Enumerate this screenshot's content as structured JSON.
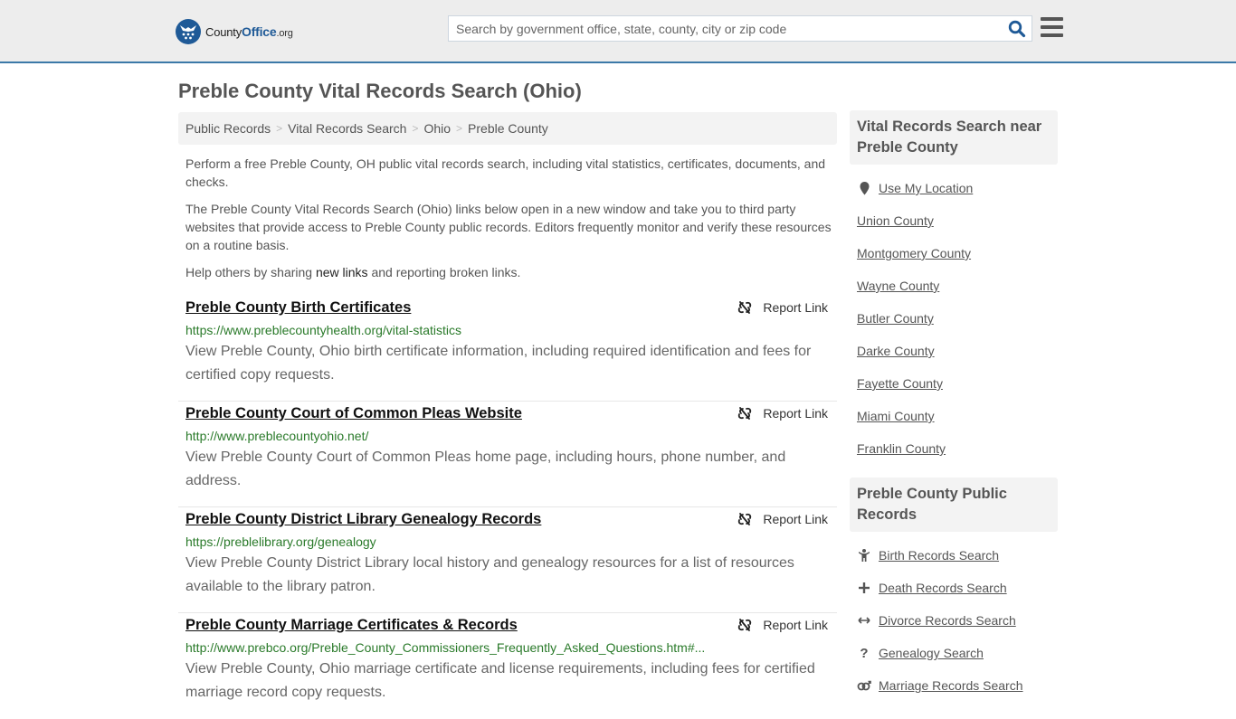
{
  "header": {
    "logo": {
      "name_a": "County",
      "name_b": "Office",
      "name_c": ".org"
    },
    "search": {
      "placeholder": "Search by government office, state, county, city or zip code",
      "value": ""
    },
    "colors": {
      "brand": "#1f5a97",
      "topbar_bg": "#ededed",
      "topbar_border": "#3c79a8"
    }
  },
  "page": {
    "title": "Preble County Vital Records Search (Ohio)",
    "breadcrumb": [
      "Public Records",
      "Vital Records Search",
      "Ohio",
      "Preble County"
    ],
    "intro": {
      "p1": "Perform a free Preble County, OH public vital records search, including vital statistics, certificates, documents, and checks.",
      "p2": "The Preble County Vital Records Search (Ohio) links below open in a new window and take you to third party websites that provide access to Preble County public records. Editors frequently monitor and verify these resources on a routine basis.",
      "p3_before": "Help others by sharing ",
      "p3_link": "new links",
      "p3_after": " and reporting broken links."
    },
    "report_label": "Report Link",
    "results": [
      {
        "title": "Preble County Birth Certificates",
        "url": "https://www.preblecountyhealth.org/vital-statistics",
        "desc": "View Preble County, Ohio birth certificate information, including required identification and fees for certified copy requests."
      },
      {
        "title": "Preble County Court of Common Pleas Website",
        "url": "http://www.preblecountyohio.net/",
        "desc": "View Preble County Court of Common Pleas home page, including hours, phone number, and address."
      },
      {
        "title": "Preble County District Library Genealogy Records",
        "url": "https://preblelibrary.org/genealogy",
        "desc": "View Preble County District Library local history and genealogy resources for a list of resources available to the library patron."
      },
      {
        "title": "Preble County Marriage Certificates & Records",
        "url": "http://www.prebco.org/Preble_County_Commissioners_Frequently_Asked_Questions.htm#...",
        "desc": "View Preble County, Ohio marriage certificate and license requirements, including fees for certified marriage record copy requests."
      }
    ]
  },
  "sidebar": {
    "nearby": {
      "heading": "Vital Records Search near Preble County",
      "use_location": "Use My Location",
      "items": [
        "Union County",
        "Montgomery County",
        "Wayne County",
        "Butler County",
        "Darke County",
        "Fayette County",
        "Miami County",
        "Franklin County"
      ]
    },
    "public_records": {
      "heading": "Preble County Public Records",
      "items": [
        {
          "label": "Birth Records Search",
          "icon": "child-icon",
          "glyph": "🧍"
        },
        {
          "label": "Death Records Search",
          "icon": "plus-icon",
          "glyph": "✚"
        },
        {
          "label": "Divorce Records Search",
          "icon": "arrows-horizontal-icon",
          "glyph": "↔"
        },
        {
          "label": "Genealogy Search",
          "icon": "question-icon",
          "glyph": "?"
        },
        {
          "label": "Marriage Records Search",
          "icon": "marriage-symbol-icon",
          "glyph": "⚤"
        }
      ]
    }
  }
}
